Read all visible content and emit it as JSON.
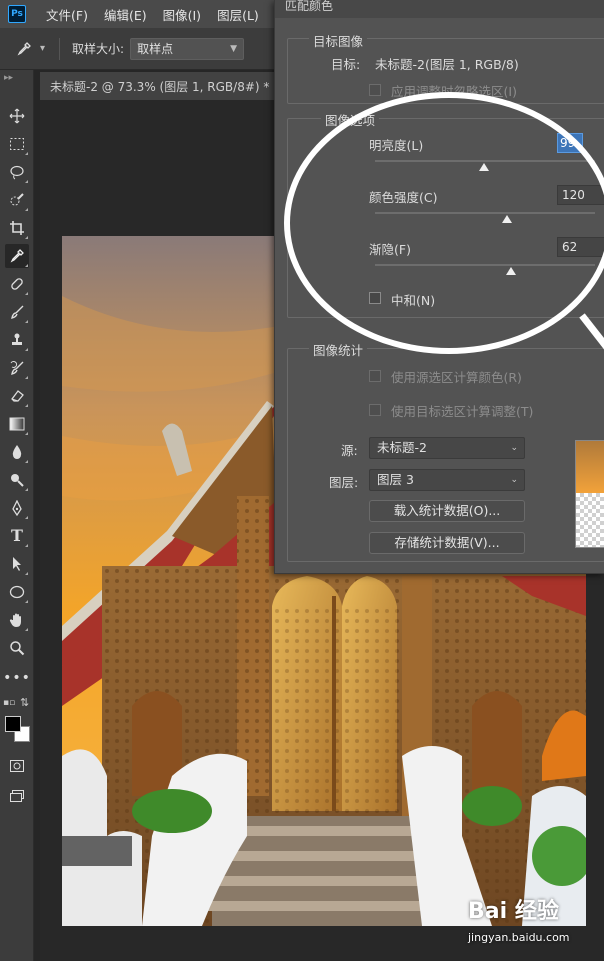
{
  "app": {
    "logo": "Ps"
  },
  "menu": [
    "文件(F)",
    "编辑(E)",
    "图像(I)",
    "图层(L)"
  ],
  "options_bar": {
    "tool_icon": "eyedropper-icon",
    "sample_size_label": "取样大小:",
    "sample_size_value": "取样点"
  },
  "document": {
    "tab_title": "未标题-2 @ 73.3% (图层 1, RGB/8#) *"
  },
  "toolbar": {
    "tools": [
      "move",
      "marquee",
      "lasso",
      "quick-select",
      "crop",
      "eyedropper",
      "healing",
      "brush",
      "stamp",
      "history-brush",
      "eraser",
      "gradient",
      "blur",
      "dodge",
      "pen",
      "type",
      "path-select",
      "shape",
      "hand",
      "zoom",
      "more"
    ],
    "foreground_color": "#000000",
    "background_color": "#ffffff"
  },
  "dialog": {
    "title": "匹配颜色",
    "target_group": {
      "legend": "目标图像",
      "target_label": "目标:",
      "target_value": "未标题-2(图层 1, RGB/8)",
      "ignore_selection_label": "应用调整时忽略选区(I)"
    },
    "image_options": {
      "legend": "图像选项",
      "luminance_label": "明亮度(L)",
      "luminance_value": "99",
      "luminance_fraction": 0.495,
      "color_intensity_label": "颜色强度(C)",
      "color_intensity_value": "120",
      "color_intensity_fraction": 0.6,
      "fade_label": "渐隐(F)",
      "fade_value": "62",
      "fade_fraction": 0.62,
      "neutralize_label": "中和(N)"
    },
    "image_stats": {
      "legend": "图像统计",
      "use_source_selection_label": "使用源选区计算颜色(R)",
      "use_target_selection_label": "使用目标选区计算调整(T)",
      "source_label": "源:",
      "source_value": "未标题-2",
      "layer_label": "图层:",
      "layer_value": "图层 3",
      "load_stats_button": "载入统计数据(O)...",
      "save_stats_button": "存储统计数据(V)..."
    }
  },
  "watermark": {
    "logo": "Bai 经验",
    "url": "jingyan.baidu.com"
  }
}
